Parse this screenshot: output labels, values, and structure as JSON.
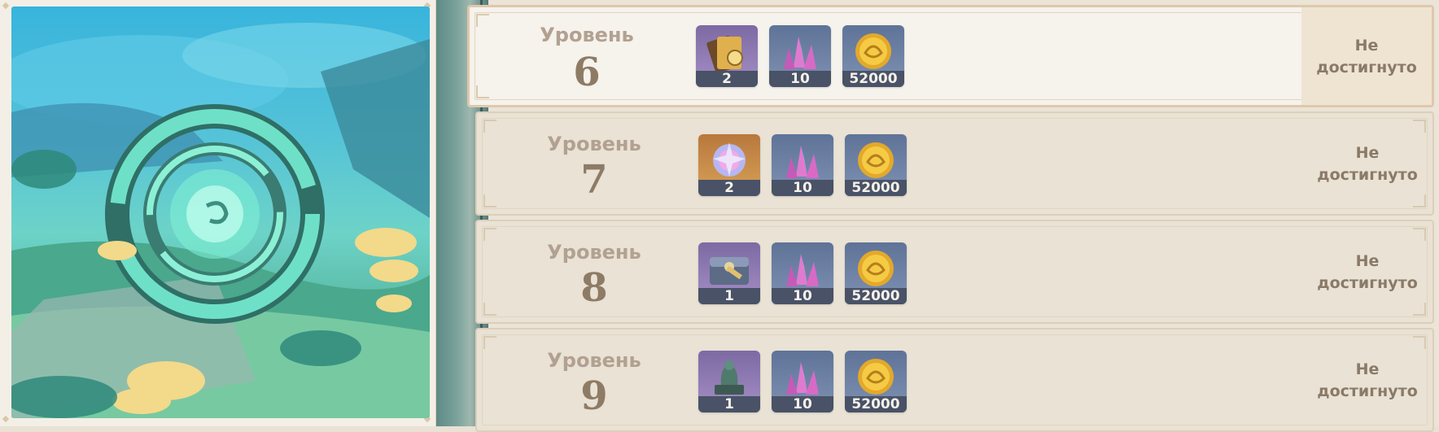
{
  "levels": [
    {
      "label": "Уровень",
      "number": "6",
      "status_line1": "Не",
      "status_line2": "достигнуто",
      "active": true,
      "rewards": [
        {
          "icon": "book-icon",
          "rarity": "purple",
          "count": "2"
        },
        {
          "icon": "crystal-icon",
          "rarity": "blue",
          "count": "10"
        },
        {
          "icon": "mora-coin-icon",
          "rarity": "blue",
          "count": "52000"
        }
      ]
    },
    {
      "label": "Уровень",
      "number": "7",
      "status_line1": "Не",
      "status_line2": "достигнуто",
      "active": false,
      "rewards": [
        {
          "icon": "star-orb-icon",
          "rarity": "gold",
          "count": "2"
        },
        {
          "icon": "crystal-icon",
          "rarity": "blue",
          "count": "10"
        },
        {
          "icon": "mora-coin-icon",
          "rarity": "blue",
          "count": "52000"
        }
      ]
    },
    {
      "label": "Уровень",
      "number": "8",
      "status_line1": "Не",
      "status_line2": "достигнуто",
      "active": false,
      "rewards": [
        {
          "icon": "chest-icon",
          "rarity": "purple",
          "count": "1"
        },
        {
          "icon": "crystal-icon",
          "rarity": "blue",
          "count": "10"
        },
        {
          "icon": "mora-coin-icon",
          "rarity": "blue",
          "count": "52000"
        }
      ]
    },
    {
      "label": "Уровень",
      "number": "9",
      "status_line1": "Не",
      "status_line2": "достигнуто",
      "active": false,
      "rewards": [
        {
          "icon": "jade-figurine-icon",
          "rarity": "purple",
          "count": "1"
        },
        {
          "icon": "crystal-icon",
          "rarity": "blue",
          "count": "10"
        },
        {
          "icon": "mora-coin-icon",
          "rarity": "blue",
          "count": "52000"
        }
      ]
    }
  ],
  "colors": {
    "panel_bg": "#e9e2d5",
    "active_bg": "#f6f2ec",
    "level_text": "#8e7b66",
    "count_bar": "#495266"
  }
}
